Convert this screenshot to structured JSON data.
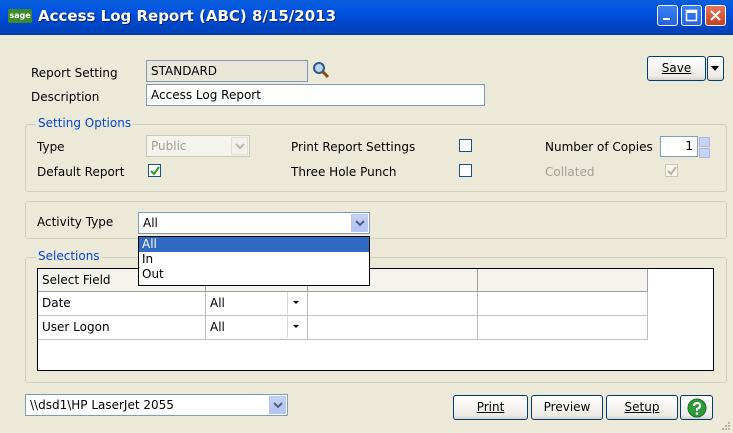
{
  "window": {
    "title": "Access Log Report (ABC) 8/15/2013",
    "app_icon_text": "sage"
  },
  "report_setting": {
    "label": "Report Setting",
    "value": "STANDARD"
  },
  "description": {
    "label": "Description",
    "value": "Access Log Report"
  },
  "save_button": {
    "label": "Save"
  },
  "setting_options": {
    "title": "Setting Options",
    "type_label": "Type",
    "type_value": "Public",
    "print_report_settings_label": "Print Report Settings",
    "number_of_copies_label": "Number of Copies",
    "number_of_copies_value": "1",
    "default_report_label": "Default Report",
    "default_report_checked": true,
    "three_hole_punch_label": "Three Hole Punch",
    "three_hole_punch_checked": false,
    "print_report_settings_checked": false,
    "collated_label": "Collated",
    "collated_checked": true
  },
  "activity_type": {
    "label": "Activity Type",
    "value": "All",
    "options": [
      "All",
      "In",
      "Out"
    ]
  },
  "selections": {
    "title": "Selections",
    "columns": [
      "Select Field",
      "",
      "",
      ""
    ],
    "rows": [
      {
        "field": "Date",
        "select": "All"
      },
      {
        "field": "User Logon",
        "select": "All"
      }
    ]
  },
  "printer": {
    "value": "\\\\dsd1\\HP LaserJet 2055"
  },
  "buttons": {
    "print": "Print",
    "preview": "Preview",
    "setup": "Setup"
  },
  "colors": {
    "title_bar": "#0054e3",
    "accent": "#0046d5",
    "selection": "#316ac5",
    "help": "#2e9b3a"
  }
}
